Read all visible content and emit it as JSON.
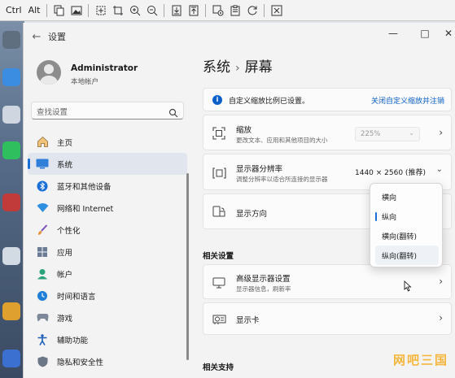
{
  "toolbar": {
    "ctrl_label": "Ctrl",
    "alt_label": "Alt",
    "icons": [
      "copy-icon",
      "image-icon",
      "fit-icon",
      "crop-icon",
      "zoom-in-icon",
      "zoom-out-icon",
      "download-icon",
      "upload-icon",
      "settings-icon",
      "clipboard-icon",
      "refresh-icon",
      "close-icon"
    ]
  },
  "window": {
    "app_title": "设置",
    "controls": [
      "—",
      "□",
      "✕"
    ]
  },
  "user": {
    "name": "Administrator",
    "subtitle": "本地帐户"
  },
  "search": {
    "placeholder": "查找设置"
  },
  "nav": {
    "items": [
      {
        "label": "主页",
        "icon": "home-icon"
      },
      {
        "label": "系统",
        "icon": "monitor-icon",
        "selected": true
      },
      {
        "label": "蓝牙和其他设备",
        "icon": "bluetooth-icon"
      },
      {
        "label": "网络和 Internet",
        "icon": "wifi-icon"
      },
      {
        "label": "个性化",
        "icon": "brush-icon"
      },
      {
        "label": "应用",
        "icon": "apps-icon"
      },
      {
        "label": "帐户",
        "icon": "account-icon"
      },
      {
        "label": "时间和语言",
        "icon": "clock-globe-icon"
      },
      {
        "label": "游戏",
        "icon": "game-controller-icon"
      },
      {
        "label": "辅助功能",
        "icon": "accessibility-icon"
      },
      {
        "label": "隐私和安全性",
        "icon": "shield-icon"
      }
    ]
  },
  "breadcrumb": {
    "parent": "系统",
    "separator": "›",
    "current": "屏幕"
  },
  "info_banner": {
    "text": "自定义缩放比例已设置。",
    "link": "关闭自定义缩放并注销"
  },
  "settings": {
    "scale": {
      "title": "缩放",
      "subtitle": "更改文本、应用和其他项目的大小",
      "value": "225%"
    },
    "resolution": {
      "title": "显示器分辨率",
      "subtitle": "调整分辨率以适合所连接的显示器",
      "value": "1440 × 2560 (推荐)"
    },
    "orientation": {
      "title": "显示方向"
    }
  },
  "related_settings": {
    "heading": "相关设置",
    "advanced": {
      "title": "高级显示器设置",
      "subtitle": "显示器信息，刷新率"
    },
    "gpu": {
      "title": "显示卡"
    }
  },
  "related_support": {
    "heading": "相关支持"
  },
  "orientation_dropdown": {
    "options": [
      "横向",
      "纵向",
      "横向(翻转)",
      "纵向(翻转)"
    ],
    "selected": "纵向",
    "hovered": "纵向(翻转)"
  },
  "watermark": "网吧三国",
  "colors": {
    "accent": "#1a6fd6",
    "link": "#0a5fc8",
    "watermark": "#f5b63e"
  }
}
